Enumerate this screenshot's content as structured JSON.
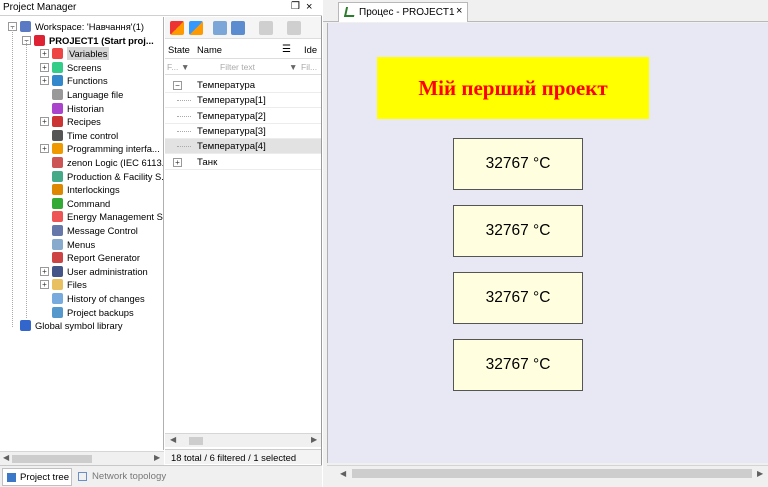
{
  "project_manager": {
    "title": "Project Manager",
    "pin": "❒",
    "close": "×",
    "tree": [
      {
        "label": "Workspace: 'Навчання'(1)",
        "icon": "workspace-icon",
        "bold": false,
        "expander": "-"
      },
      {
        "label": "PROJECT1 (Start proj...",
        "icon": "project-icon",
        "bold": true,
        "expander": "-"
      },
      {
        "label": "Variables",
        "icon": "variables-icon",
        "bold": false,
        "expander": "+",
        "selected": true
      },
      {
        "label": "Screens",
        "icon": "screens-icon",
        "bold": false,
        "expander": "+"
      },
      {
        "label": "Functions",
        "icon": "functions-icon",
        "bold": false,
        "expander": "+"
      },
      {
        "label": "Language file",
        "icon": "language-icon",
        "bold": false,
        "expander": ""
      },
      {
        "label": "Historian",
        "icon": "historian-icon",
        "bold": false,
        "expander": ""
      },
      {
        "label": "Recipes",
        "icon": "recipes-icon",
        "bold": false,
        "expander": "+"
      },
      {
        "label": "Time control",
        "icon": "clock-icon",
        "bold": false,
        "expander": ""
      },
      {
        "label": "Programming interfa...",
        "icon": "programming-icon",
        "bold": false,
        "expander": "+"
      },
      {
        "label": "zenon Logic (IEC 6113...",
        "icon": "logic-icon",
        "bold": false,
        "expander": ""
      },
      {
        "label": "Production & Facility S...",
        "icon": "production-icon",
        "bold": false,
        "expander": ""
      },
      {
        "label": "Interlockings",
        "icon": "lock-icon",
        "bold": false,
        "expander": ""
      },
      {
        "label": "Command",
        "icon": "command-icon",
        "bold": false,
        "expander": ""
      },
      {
        "label": "Energy Management S...",
        "icon": "energy-icon",
        "bold": false,
        "expander": ""
      },
      {
        "label": "Message Control",
        "icon": "message-icon",
        "bold": false,
        "expander": ""
      },
      {
        "label": "Menus",
        "icon": "menu-icon",
        "bold": false,
        "expander": ""
      },
      {
        "label": "Report Generator",
        "icon": "report-icon",
        "bold": false,
        "expander": ""
      },
      {
        "label": "User administration",
        "icon": "users-icon",
        "bold": false,
        "expander": "+"
      },
      {
        "label": "Files",
        "icon": "folder-icon",
        "bold": false,
        "expander": "+"
      },
      {
        "label": "History of changes",
        "icon": "history-icon",
        "bold": false,
        "expander": ""
      },
      {
        "label": "Project backups",
        "icon": "backup-icon",
        "bold": false,
        "expander": ""
      },
      {
        "label": "Global symbol library",
        "icon": "library-icon",
        "bold": false,
        "expander": ""
      }
    ],
    "variables": {
      "columns": [
        "State",
        "Name",
        "Ide"
      ],
      "filter_left": "F...",
      "filter_name": "Filter text",
      "filter_right": "Fil...",
      "rows": [
        {
          "name": "Температура",
          "expander": "-",
          "selected": false
        },
        {
          "name": "Температура[1]",
          "expander": "",
          "selected": false
        },
        {
          "name": "Температура[2]",
          "expander": "",
          "selected": false
        },
        {
          "name": "Температура[3]",
          "expander": "",
          "selected": false
        },
        {
          "name": "Температура[4]",
          "expander": "",
          "selected": true
        },
        {
          "name": "Танк",
          "expander": "+",
          "selected": false
        }
      ],
      "status": "18 total / 6 filtered / 1 selected"
    },
    "bottom_tabs": [
      "Project tree",
      "Network topology"
    ]
  },
  "editor": {
    "tab_title": "Процес - PROJECT1",
    "tab_close": "×",
    "banner": "Мій перший проект",
    "banner_bg": "#ffff00",
    "banner_color": "#ff0000",
    "canvas_bg": "#e8e8f4",
    "temps": [
      "32767  °C",
      "32767  °C",
      "32767  °C",
      "32767  °C"
    ]
  }
}
